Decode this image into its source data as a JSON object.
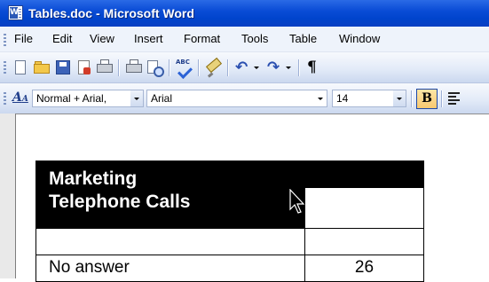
{
  "window": {
    "title": "Tables.doc - Microsoft Word"
  },
  "menubar": {
    "items": [
      "File",
      "Edit",
      "View",
      "Insert",
      "Format",
      "Tools",
      "Table",
      "Window"
    ]
  },
  "toolbar_standard": {
    "icons": [
      "new-icon",
      "open-icon",
      "save-icon",
      "permission-icon",
      "print-icon",
      "print-preview-icon",
      "spelling-icon",
      "format-painter-icon",
      "undo-icon",
      "redo-icon",
      "pilcrow-icon"
    ],
    "spelling_glyph": "ABC",
    "pilcrow_glyph": "¶"
  },
  "toolbar_formatting": {
    "style_value": "Normal + Arial,",
    "font_value": "Arial",
    "size_value": "14",
    "bold_label": "B"
  },
  "document": {
    "table": {
      "header_line1": "Marketing",
      "header_line2": "Telephone Calls",
      "rows": [
        {
          "label": "",
          "value": ""
        },
        {
          "label": "No answer",
          "value": "26"
        }
      ]
    }
  },
  "colors": {
    "titlebar": "#0a4cd6",
    "menubar": "#eef3fb",
    "table_header_bg": "#000000"
  }
}
